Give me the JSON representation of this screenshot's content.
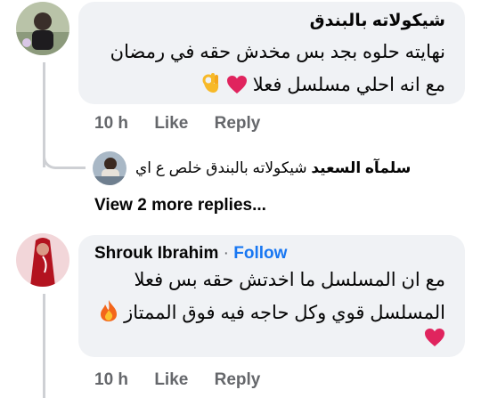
{
  "comment1": {
    "author": "شيكولاته بالبندق",
    "text_line1": "نهايته حلوه بجد بس مخدش حقه في رمضان",
    "text_line2": "مع انه احلي مسلسل فعلا",
    "time": "10 h",
    "like_label": "Like",
    "reply_label": "Reply",
    "reply_preview": {
      "author": "سلمآه السعيد",
      "text": "شيكولاته بالبندق خلص ع اي"
    },
    "more_replies_label": "View 2 more replies..."
  },
  "comment2": {
    "author": "Shrouk Ibrahim",
    "separator": "·",
    "follow_label": "Follow",
    "text_line1": "مع ان المسلسل ما اخدتش حقه بس فعلا",
    "text_line2": "المسلسل قوي وكل حاجه فيه فوق الممتاز",
    "time": "10 h",
    "like_label": "Like",
    "reply_label": "Reply"
  },
  "icons": {
    "heart": "heart-icon",
    "ok_hand": "ok-hand-icon",
    "fire": "fire-icon",
    "reply_connector": "reply-connector"
  },
  "colors": {
    "bubble": "#f0f2f5",
    "meta": "#65676b",
    "link": "#1877f2",
    "heart": "#e0245e",
    "thread_line": "#ced0d4"
  }
}
